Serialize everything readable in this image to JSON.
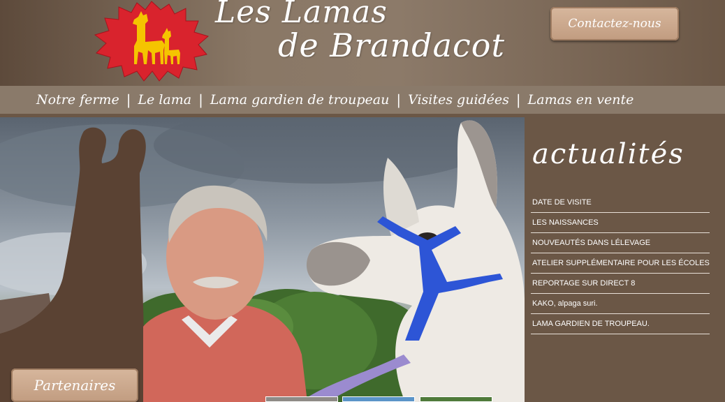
{
  "header": {
    "title_line1": "Les Lamas",
    "title_line2": "de Brandacot",
    "contact_label": "Contactez-nous"
  },
  "nav": {
    "items": [
      {
        "label": "Notre ferme"
      },
      {
        "label": "Le lama"
      },
      {
        "label": "Lama gardien de troupeau"
      },
      {
        "label": "Visites guidées"
      },
      {
        "label": "Lamas en vente"
      }
    ],
    "separator": "|"
  },
  "news": {
    "title": "actualités",
    "items": [
      {
        "label": "DATE DE VISITE"
      },
      {
        "label": "LES NAISSANCES"
      },
      {
        "label": "NOUVEAUTÉS DANS LÉLEVAGE"
      },
      {
        "label": "ATELIER SUPPLÉMENTAIRE POUR LES ÉCOLES PRIMAIRES"
      },
      {
        "label": "REPORTAGE SUR DIRECT 8"
      },
      {
        "label": "KAKO, alpaga suri."
      },
      {
        "label": "LAMA GARDIEN DE TROUPEAU."
      }
    ]
  },
  "footer": {
    "partners_label": "Partenaires"
  },
  "colors": {
    "background": "#6b5746",
    "nav_bar": "#8a7a6a",
    "button": "#c9a58a",
    "logo_leaf": "#d9232d",
    "logo_llama": "#f5c400",
    "halter": "#2d55d6"
  }
}
